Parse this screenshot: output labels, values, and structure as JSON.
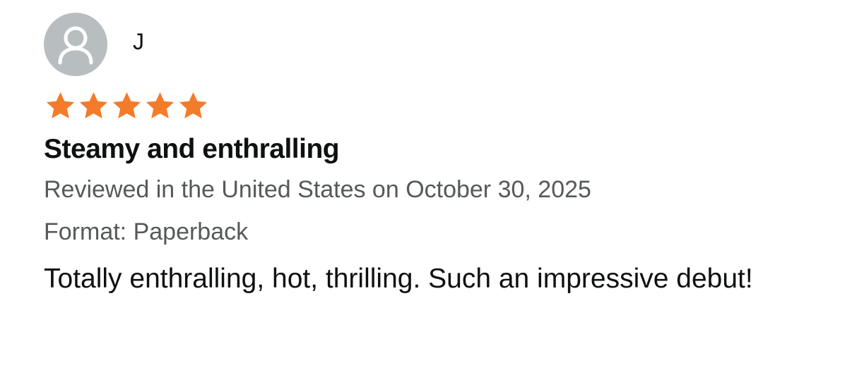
{
  "review": {
    "author": "J",
    "rating": 5,
    "rating_max": 5,
    "star_color": "#f47b2a",
    "avatar_icon": "user-silhouette-icon",
    "title": "Steamy and enthralling",
    "reviewed_line": "Reviewed in the United States on October 30, 2025",
    "format": "Format: Paperback",
    "text": "Totally enthralling, hot, thrilling. Such an impressive debut!"
  }
}
